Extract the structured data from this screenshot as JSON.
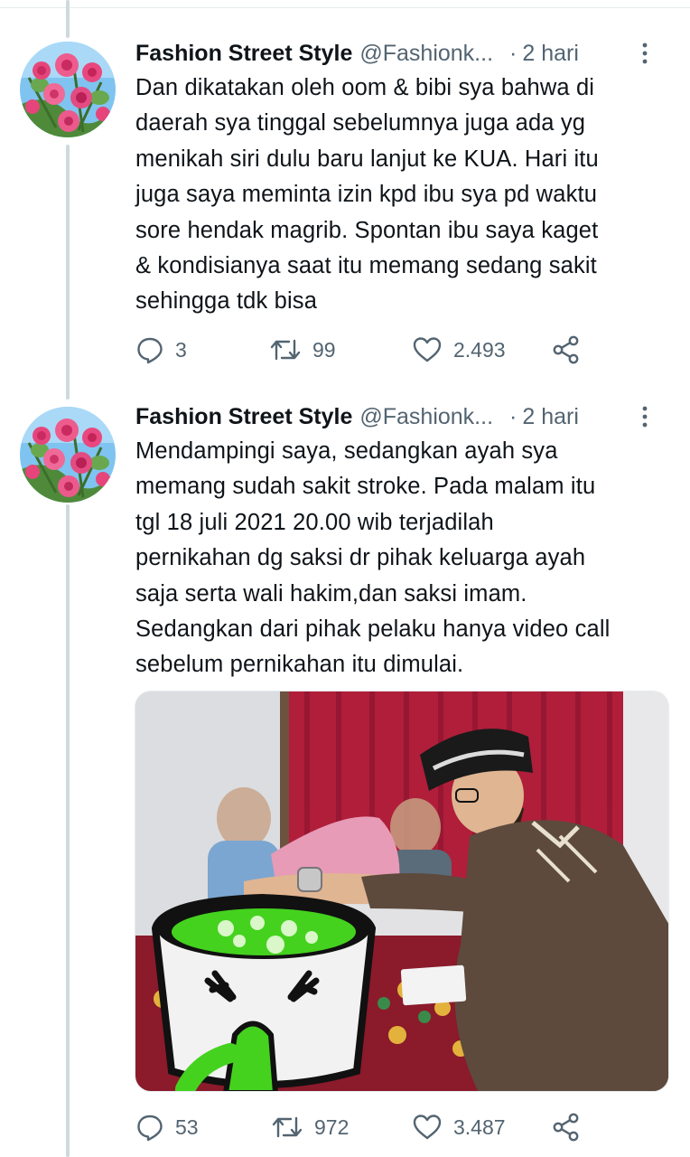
{
  "tweets": [
    {
      "display_name": "Fashion Street Style",
      "handle": "@Fashionk...",
      "separator": "·",
      "time": "2 hari",
      "text_lines": [
        "Dan dikatakan oleh oom & bibi sya bahwa di",
        "daerah sya tinggal sebelumnya juga ada yg",
        "menikah siri dulu baru lanjut ke KUA. Hari itu",
        "juga saya meminta izin kpd ibu sya pd waktu",
        "sore hendak magrib. Spontan ibu saya kaget",
        "& kondisianya saat itu memang sedang sakit",
        "sehingga tdk bisa"
      ],
      "replies": "3",
      "retweets": "99",
      "likes": "2.493"
    },
    {
      "display_name": "Fashion Street Style",
      "handle": "@Fashionk...",
      "separator": "·",
      "time": "2 hari",
      "text_lines": [
        "Mendampingi saya, sedangkan ayah sya",
        "memang sudah sakit stroke. Pada malam itu",
        "tgl 18 juli 2021 20.00 wib terjadilah",
        "pernikahan dg saksi dr pihak keluarga ayah",
        "saja serta wali hakim,dan saksi imam.",
        "Sedangkan dari pihak pelaku hanya video call",
        "sebelum pernikahan itu dimulai."
      ],
      "replies": "53",
      "retweets": "972",
      "likes": "3.487"
    }
  ],
  "icons": {
    "reply": "speech-bubble-icon",
    "retweet": "retweet-arrows-icon",
    "like": "heart-icon",
    "share": "share-nodes-icon",
    "more": "vertical-dots-icon"
  },
  "colors": {
    "text": "#0f1419",
    "secondary": "#536471",
    "thread_line": "#cfd9de",
    "divider": "#e6ecf0",
    "curtain": "#b01e3a",
    "sticker_green": "#44d21e"
  }
}
